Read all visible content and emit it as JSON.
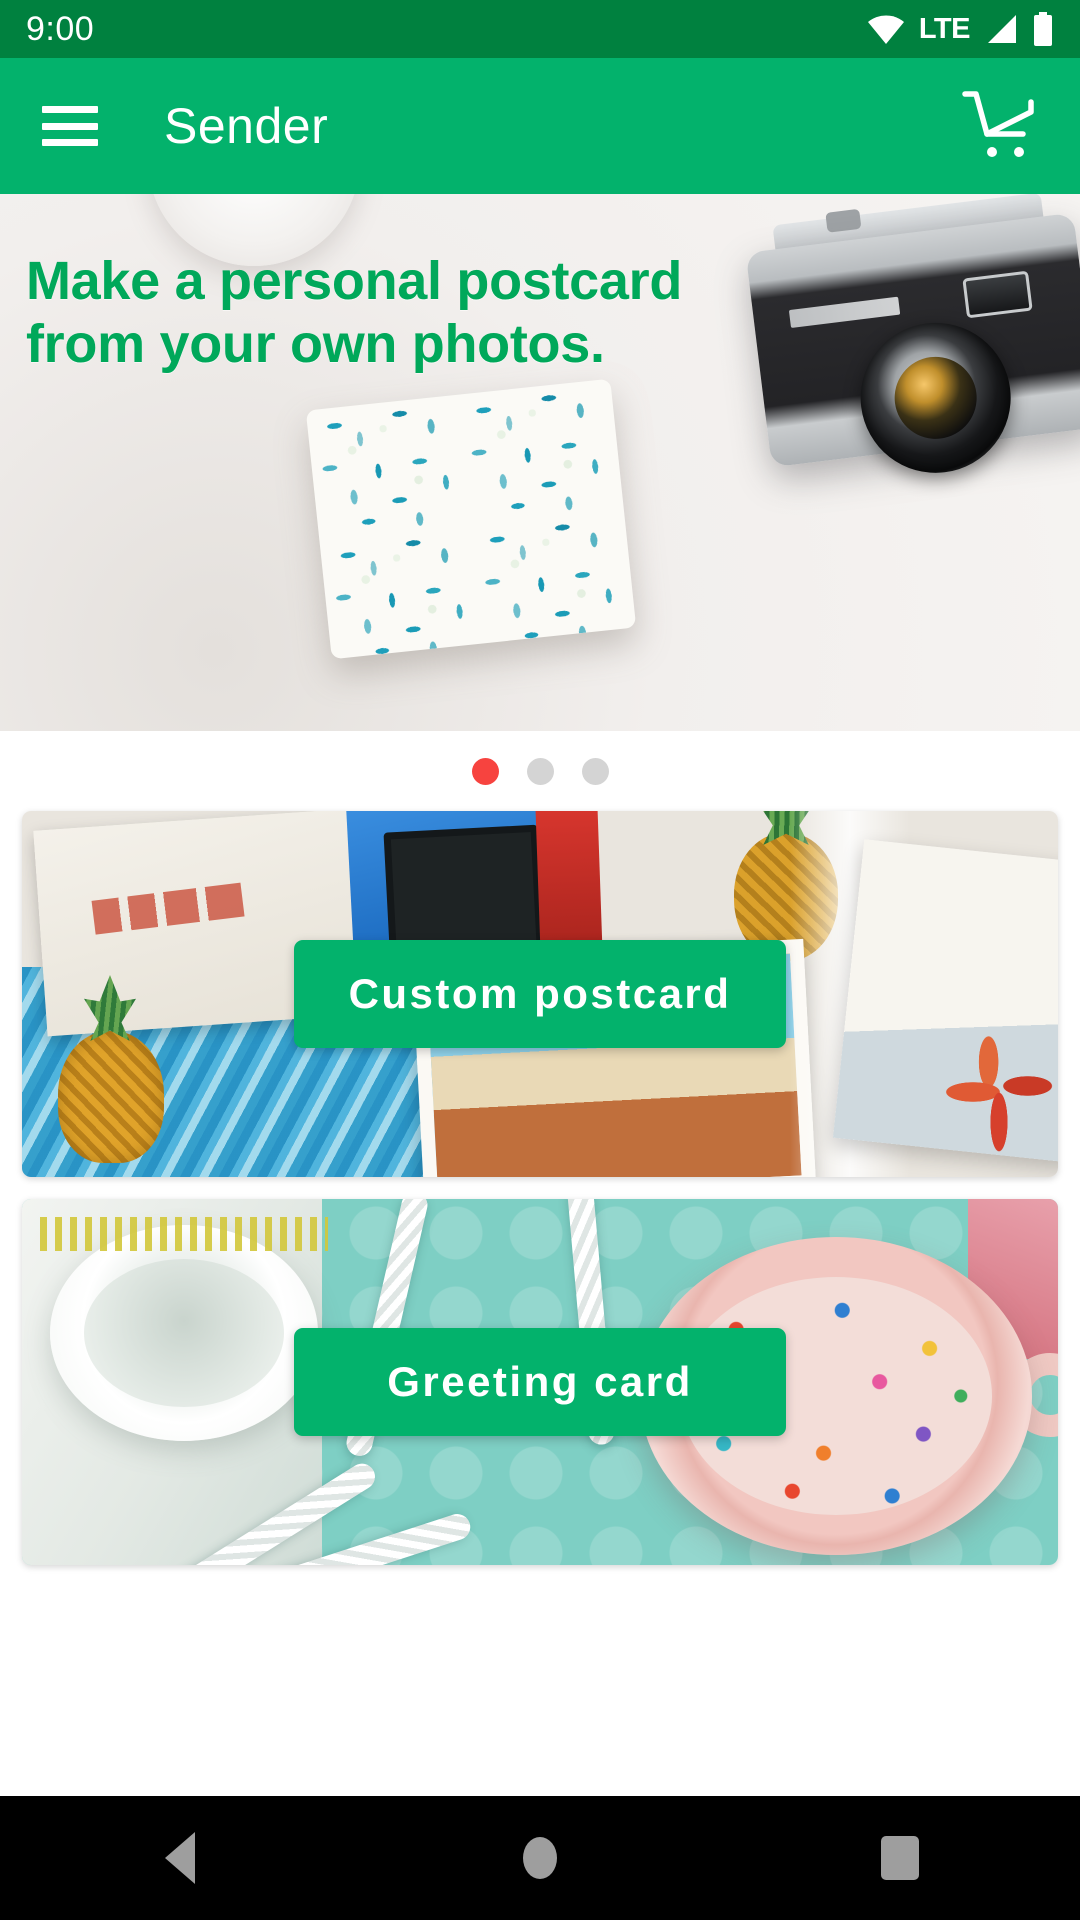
{
  "status_bar": {
    "time": "9:00",
    "network_type": "LTE",
    "icons": [
      "wifi-icon",
      "signal-icon",
      "battery-icon"
    ]
  },
  "app_bar": {
    "title": "Sender",
    "menu_icon": "hamburger-menu-icon",
    "cart_icon": "shopping-cart-icon"
  },
  "hero": {
    "headline_line1": "Make a personal postcard",
    "headline_line2": "from your own photos.",
    "text_color": "#00A85A"
  },
  "carousel": {
    "total_slides": 3,
    "active_index": 0,
    "active_color": "#F7433F",
    "inactive_color": "#D4D4D4"
  },
  "categories": [
    {
      "button_label": "Custom postcard",
      "image_name": "postcard-collage-photo"
    },
    {
      "button_label": "Greeting card",
      "image_name": "birthday-sprinkles-photo"
    }
  ],
  "theme": {
    "primary_green": "#03B26C",
    "status_bar_green": "#00813F",
    "button_text": "#FFFFFF"
  },
  "nav_bar": {
    "back_label": "back-button",
    "home_label": "home-button",
    "recents_label": "recents-button"
  }
}
